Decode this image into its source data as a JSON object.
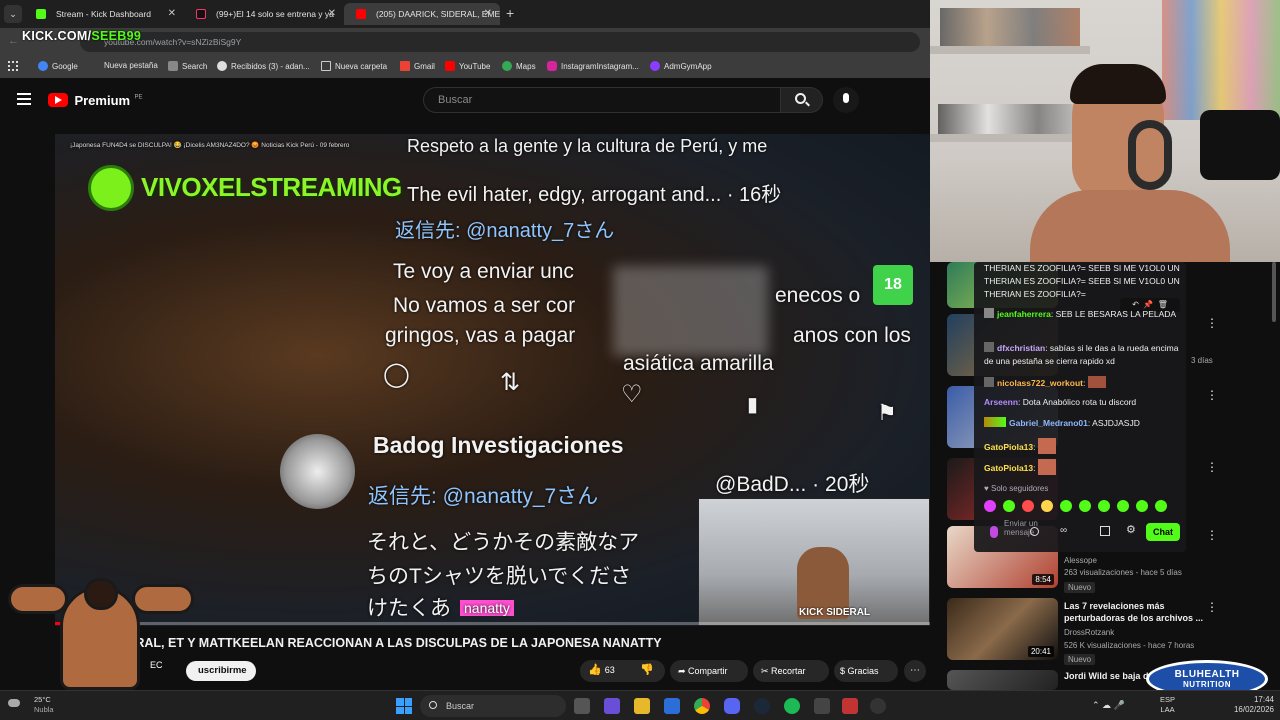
{
  "browser": {
    "tabs": [
      {
        "title": "Stream - Kick Dashboard"
      },
      {
        "title": "(99+)El 14 solo se entrena y ya"
      },
      {
        "title": "(205) DAARICK, SIDERAL, EMET"
      }
    ],
    "url": "youtube.com/watch?v=sNZizBiSg9Y",
    "kick_overlay_prefix": "KICK.COM/",
    "kick_overlay_user": "SEEB99",
    "bookmarks": [
      "Google",
      "Nueva pestaña",
      "Search",
      "Recibidos (3) - adan...",
      "Nueva carpeta",
      "Gmail",
      "YouTube",
      "Maps",
      "InstagramInstagram...",
      "AdmGymApp"
    ]
  },
  "youtube": {
    "logo": "Premium",
    "region": "PE",
    "search_placeholder": "Buscar",
    "video_title": "DERAL, ET Y MATTKEELAN REACCIONAN A LAS DISCULPAS DE LA JAPONESA NANATTY",
    "channel_short": "EC",
    "subscribe": "uscribirme",
    "likes": "63",
    "share": "Compartir",
    "clip": "Recortar",
    "thanks": "Gracias",
    "overlay_header": "¡Japonesa FUN4D4 se DISCULPA! 😂 ¡Dicelis AM3NAZ4DO? 😡 Noticias Kick Perú - 09 febrero",
    "vivox": "VIVOXELSTREAMING",
    "age_badge": "18",
    "kick_sideral": "KICK SIDERAL",
    "video_lines": [
      "Respeto a la gente y la cultura de Perú, y me",
      "The evil hater, edgy, arrogant and... · 16秒",
      "返信先: @nanatty_7さん",
      "Te voy a enviar unc",
      "enecos o",
      "No vamos a ser cor",
      "gringos, vas a pagar",
      "anos con los",
      "asiática amarilla",
      "Badog Investigaciones",
      "@BadD... · 20秒",
      "返信先: @nanatty_7さん",
      "それと、どうかその素敵なア",
      "ちのTシャツを脱いでくださ",
      "けたくあ",
      "nanatty"
    ]
  },
  "chat": {
    "messages": [
      {
        "user": "",
        "text": "THERIAN ES ZOOFILIA?= SEEB SI ME V1OL0 UN THERIAN ES ZOOFILIA?= SEEB SI ME V1OL0 UN THERIAN ES ZOOFILIA?="
      },
      {
        "user": "jeanfaherrera",
        "text": ": SEB LE BESARAS LA PELADA"
      },
      {
        "user": "dfxchristian",
        "text": ": sabías si le das a la rueda encima de una pestaña se cierra rapido xd"
      },
      {
        "user": "nicolass722_workout",
        "text": ":"
      },
      {
        "user": "Arseenn",
        "text": ": Dota Anabólico rota tu discord"
      },
      {
        "user": "Gabriel_Medrano01",
        "text": ": ASJDJASJD"
      },
      {
        "user": "GatoPiola13",
        "text": ":"
      },
      {
        "user": "GatoPiola13",
        "text": ":"
      }
    ],
    "followers_only": "Solo seguidores",
    "input_placeholder": "Enviar un mensaje",
    "chat_button": "Chat",
    "colors": {
      "accent": "#53fc18"
    }
  },
  "recommendations": [
    {
      "title": "",
      "channel": "",
      "meta": ""
    },
    {
      "title": "",
      "channel": "",
      "meta": "3 días"
    },
    {
      "title": "",
      "channel": "",
      "meta": ""
    },
    {
      "title": "",
      "channel": "",
      "meta": ""
    },
    {
      "title": "",
      "channel": "Alessope",
      "meta": "263 visualizaciones - hace 5 días",
      "badge": "Nuevo",
      "duration": "8:54"
    },
    {
      "title": "Las 7 revelaciones más perturbadoras de los archivos ...",
      "channel": "DrossRotzank",
      "meta": "526 K visualizaciones - hace 7 horas",
      "badge": "Nuevo",
      "duration": "20:41"
    },
    {
      "title": "Jordi Wild se baja de",
      "channel": "",
      "meta": ""
    }
  ],
  "taskbar": {
    "weather_temp": "25°C",
    "weather_desc": "Nubla",
    "search": "Buscar",
    "lang": "ESP",
    "lang2": "LAA",
    "time": "17:44",
    "date": "16/02/2026"
  },
  "sponsor": {
    "line1": "BLUHEALTH",
    "line2": "NUTRITION"
  }
}
